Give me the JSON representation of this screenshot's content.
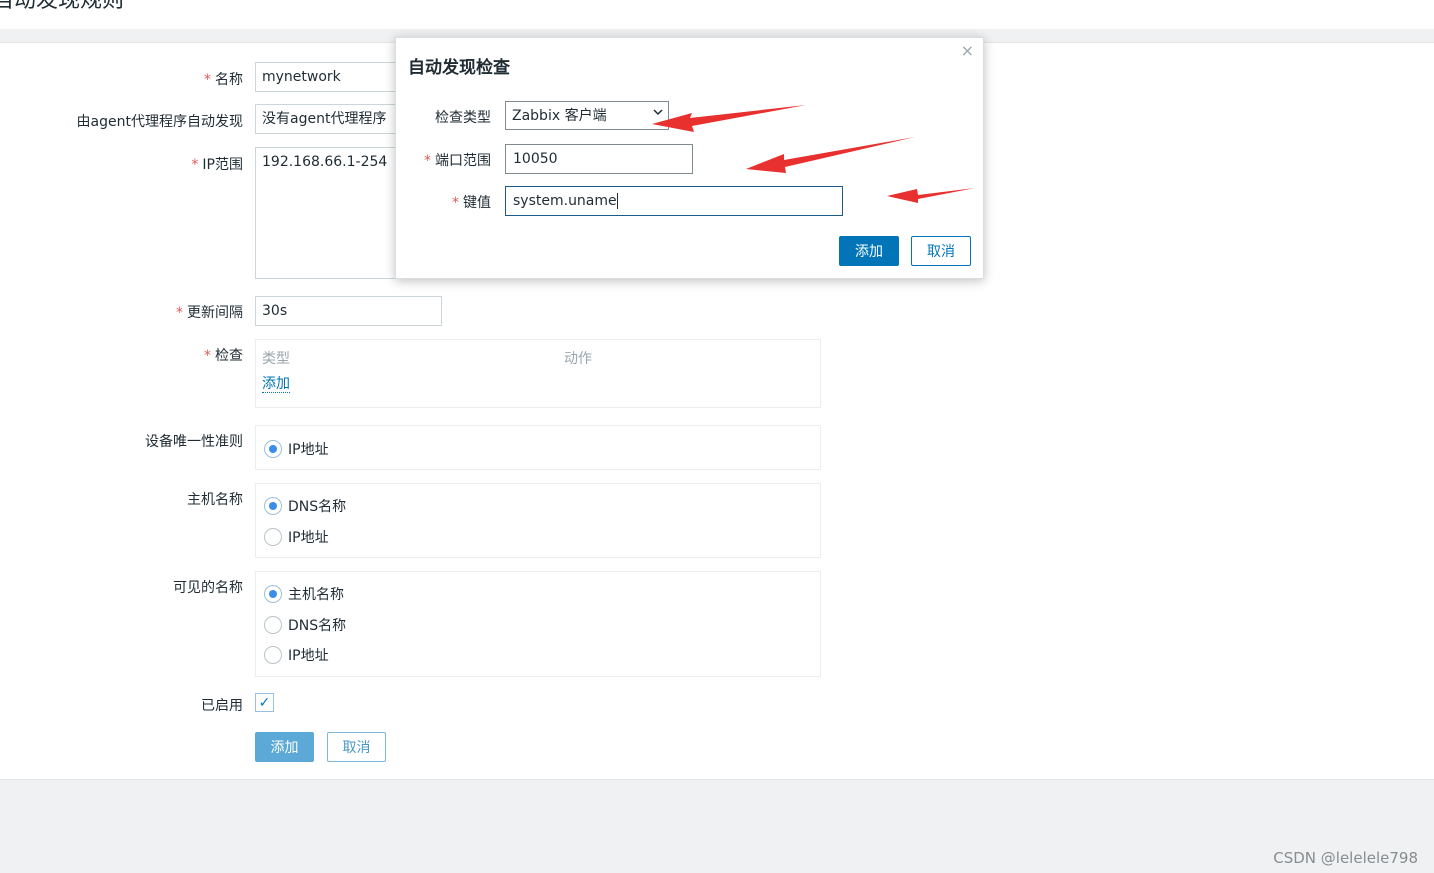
{
  "page": {
    "title": "自动发现规则",
    "watermark": "CSDN @lelelele798"
  },
  "form": {
    "name": {
      "label": "名称",
      "value": "mynetwork"
    },
    "proxy": {
      "label": "由agent代理程序自动发现",
      "value": "没有agent代理程序"
    },
    "ip_range": {
      "label": "IP范围",
      "value": "192.168.66.1-254"
    },
    "interval": {
      "label": "更新间隔",
      "value": "30s"
    },
    "checks": {
      "label": "检查",
      "col_type": "类型",
      "col_action": "动作",
      "add_link": "添加"
    },
    "uniqueness": {
      "label": "设备唯一性准则",
      "options": [
        "IP地址"
      ]
    },
    "host_name": {
      "label": "主机名称",
      "options": [
        "DNS名称",
        "IP地址"
      ]
    },
    "visible_name": {
      "label": "可见的名称",
      "options": [
        "主机名称",
        "DNS名称",
        "IP地址"
      ]
    },
    "enabled": {
      "label": "已启用",
      "checked": true
    },
    "add_button": "添加",
    "cancel_button": "取消"
  },
  "modal": {
    "title": "自动发现检查",
    "close": "×",
    "check_type": {
      "label": "检查类型",
      "value": "Zabbix 客户端"
    },
    "port_range": {
      "label": "端口范围",
      "value": "10050"
    },
    "key": {
      "label": "键值",
      "value": "system.uname"
    },
    "add_button": "添加",
    "cancel_button": "取消"
  },
  "colors": {
    "primary": "#0275b8",
    "required": "#e45959",
    "arrow": "#e8302f"
  },
  "icons": {
    "close": "close-icon",
    "select_chevron": "chevron-down-icon",
    "check": "checkmark-icon"
  }
}
